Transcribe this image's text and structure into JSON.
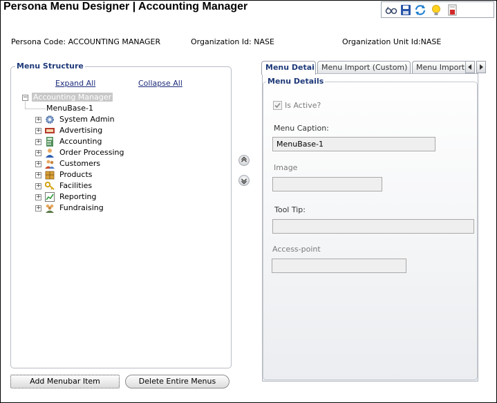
{
  "window": {
    "title": "Persona Menu Designer | Accounting Manager"
  },
  "toolbar": {
    "buttons": [
      {
        "name": "glasses-icon"
      },
      {
        "name": "save-icon"
      },
      {
        "name": "refresh-icon"
      },
      {
        "name": "lightbulb-icon"
      },
      {
        "name": "report-icon"
      }
    ]
  },
  "info": {
    "persona_code": "Persona Code: ACCOUNTING MANAGER",
    "organization_id": "Organization Id: NASE",
    "organization_unit_id": "Organization Unit Id:NASE"
  },
  "menu_structure": {
    "legend": "Menu Structure",
    "expand_all": "Expand All",
    "collapse_all": "Collapse All",
    "root": "Accounting Manager",
    "menubase": "MenuBase-1",
    "items": [
      {
        "label": "System Admin",
        "icon": "gear-icon"
      },
      {
        "label": "Advertising",
        "icon": "advertising-icon"
      },
      {
        "label": "Accounting",
        "icon": "calculator-icon"
      },
      {
        "label": "Order Processing",
        "icon": "person-icon"
      },
      {
        "label": "Customers",
        "icon": "customers-icon"
      },
      {
        "label": "Products",
        "icon": "box-icon"
      },
      {
        "label": "Facilities",
        "icon": "key-icon"
      },
      {
        "label": "Reporting",
        "icon": "chart-icon"
      },
      {
        "label": "Fundraising",
        "icon": "group-icon"
      }
    ]
  },
  "buttons": {
    "add_menubar_item": "Add Menubar Item",
    "delete_entire_menus": "Delete Entire Menus"
  },
  "tabs": [
    {
      "label": "Menu Details",
      "active": true
    },
    {
      "label": "Menu Import (Custom)",
      "active": false
    },
    {
      "label": "Menu Import",
      "active": false
    }
  ],
  "menu_details": {
    "legend": "Menu Details",
    "is_active_label": "Is Active?",
    "is_active_checked": true,
    "menu_caption_label": "Menu Caption:",
    "menu_caption_value": "MenuBase-1",
    "image_label": "Image",
    "image_value": "",
    "tool_tip_label": "Tool Tip:",
    "tool_tip_value": "",
    "access_point_label": "Access-point",
    "access_point_value": ""
  }
}
